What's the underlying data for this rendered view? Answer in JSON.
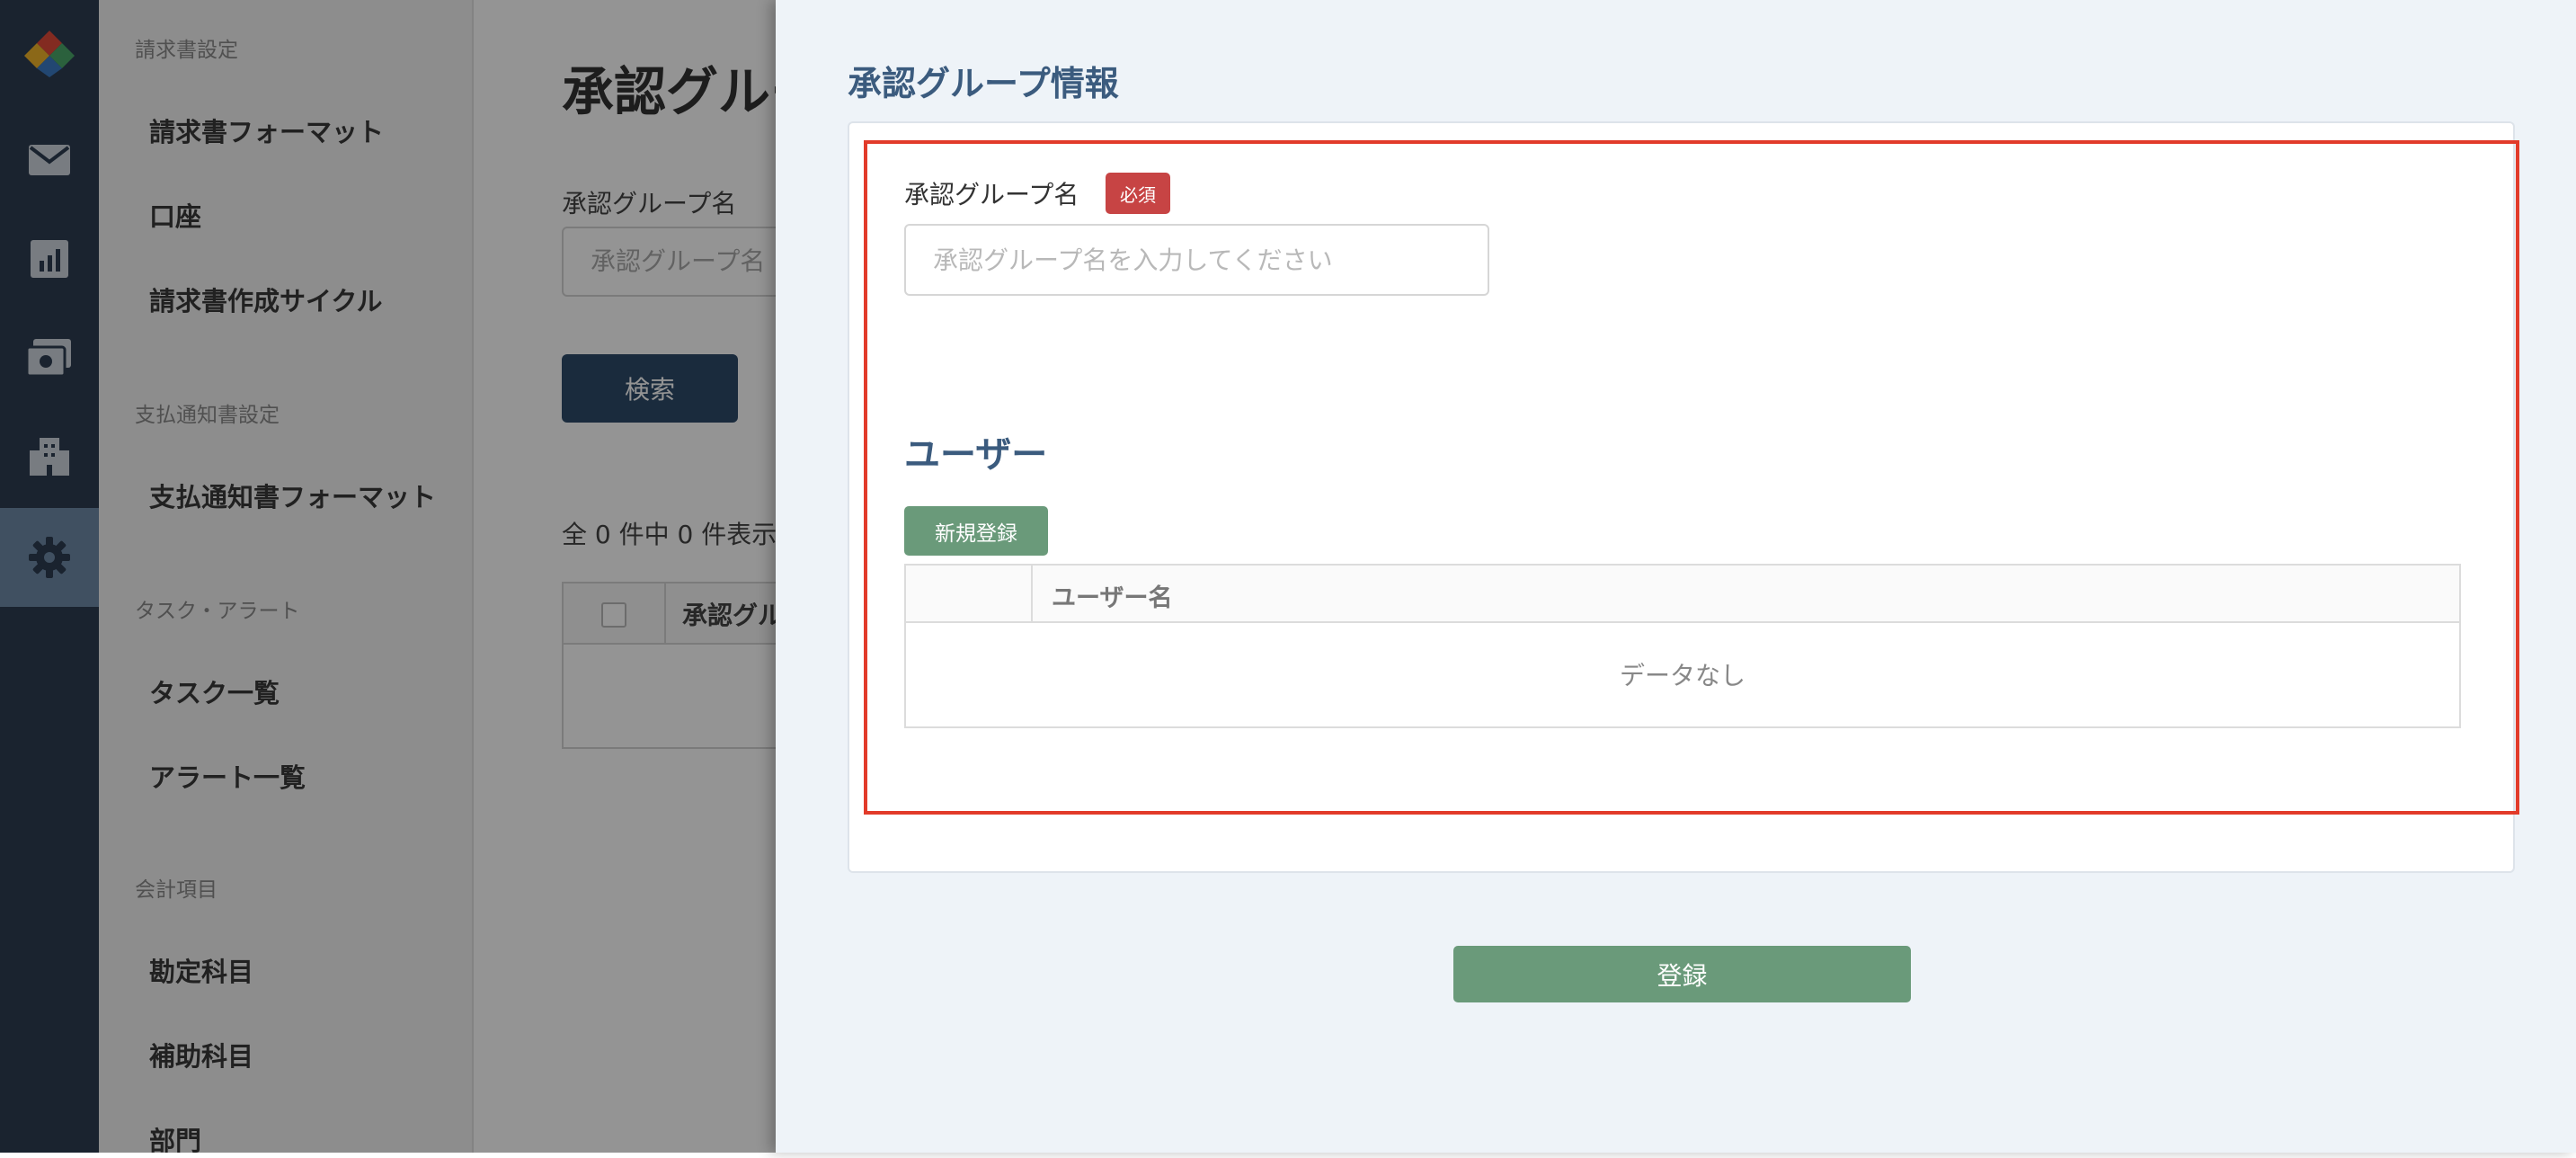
{
  "rail": {
    "icons": [
      "logo-icon",
      "mail-icon",
      "report-icon",
      "payment-icon",
      "building-icon",
      "gear-icon"
    ],
    "active": "gear-icon"
  },
  "sidebar": {
    "sections": [
      {
        "title": "請求書設定",
        "items": [
          "請求書フォーマット",
          "口座",
          "請求書作成サイクル"
        ]
      },
      {
        "title": "支払通知書設定",
        "items": [
          "支払通知書フォーマット"
        ]
      },
      {
        "title": "タスク・アラート",
        "items": [
          "タスク一覧",
          "アラート一覧"
        ]
      },
      {
        "title": "会計項目",
        "items": [
          "勘定科目",
          "補助科目",
          "部門"
        ]
      }
    ]
  },
  "main": {
    "title": "承認グループ",
    "filter_label": "承認グループ名",
    "filter_placeholder": "承認グループ名",
    "search_button": "検索",
    "count_text": "全 0 件中 0 件表示し",
    "table_col": "承認グル"
  },
  "drawer": {
    "title": "承認グループ情報",
    "field_label": "承認グループ名",
    "required_badge": "必須",
    "name_placeholder": "承認グループ名を入力してください",
    "users_heading": "ユーザー",
    "new_button": "新規登録",
    "table_header": "ユーザー名",
    "empty_text": "データなし",
    "submit_button": "登録"
  },
  "colors": {
    "rail_bg": "#2d3d51",
    "rail_active": "#6e8aa7",
    "accent_heading": "#3b5b7e",
    "green_button": "#6a9a7a",
    "required_badge": "#c74444",
    "highlight_border": "#e23b2a"
  }
}
